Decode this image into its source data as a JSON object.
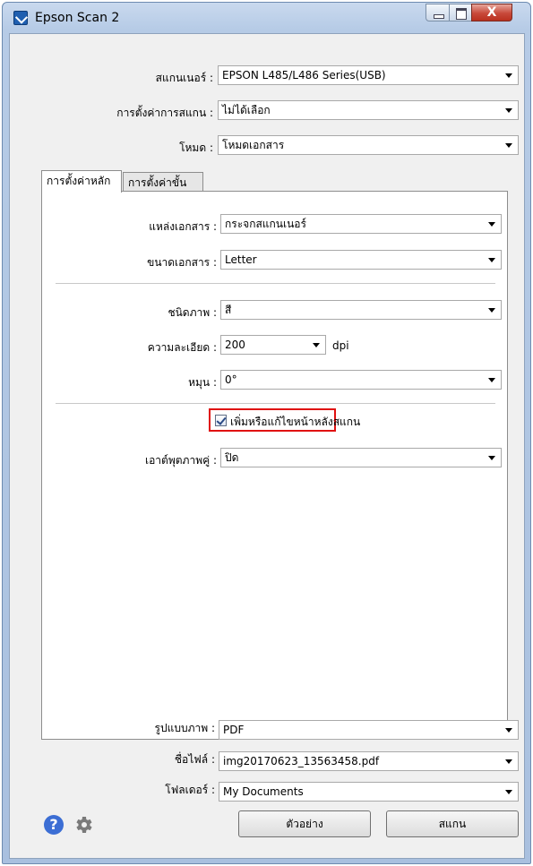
{
  "window": {
    "title": "Epson Scan 2",
    "close_glyph": "X"
  },
  "scanner": {
    "label": "สแกนเนอร์ :",
    "value": "EPSON L485/L486 Series(USB)"
  },
  "scan_settings": {
    "label": "การตั้งค่าการสแกน :",
    "value": "ไม่ได้เลือก"
  },
  "mode": {
    "label": "โหมด :",
    "value": "โหมดเอกสาร"
  },
  "tabs": [
    {
      "label": "การตั้งค่าหลัก",
      "active": true
    },
    {
      "label": "การตั้งค่าขั้นสูง",
      "active": false
    }
  ],
  "main_settings": {
    "document_source": {
      "label": "แหล่งเอกสาร :",
      "value": "กระจกสแกนเนอร์"
    },
    "document_size": {
      "label": "ขนาดเอกสาร :",
      "value": "Letter"
    },
    "image_type": {
      "label": "ชนิดภาพ :",
      "value": "สี"
    },
    "resolution": {
      "label": "ความละเอียด :",
      "value": "200",
      "unit": "dpi"
    },
    "rotate": {
      "label": "หมุน :",
      "value": "0°"
    },
    "add_edit_pages": {
      "label": "เพิ่มหรือแก้ไขหน้าหลังสแกน",
      "checked": true
    },
    "double_feed": {
      "label": "เอาต์พุตภาพคู่ :",
      "value": "ปิด"
    }
  },
  "image_format": {
    "label": "รูปแบบภาพ :",
    "value": "PDF"
  },
  "file_name": {
    "label": "ชื่อไฟล์ :",
    "value": "img20170623_13563458.pdf"
  },
  "folder": {
    "label": "โฟลเดอร์ :",
    "value": "My Documents"
  },
  "buttons": {
    "preview": "ตัวอย่าง",
    "scan": "สแกน",
    "help_glyph": "?"
  },
  "colors": {
    "highlight_border": "#e01010",
    "help_icon": "#3c6ed4"
  }
}
